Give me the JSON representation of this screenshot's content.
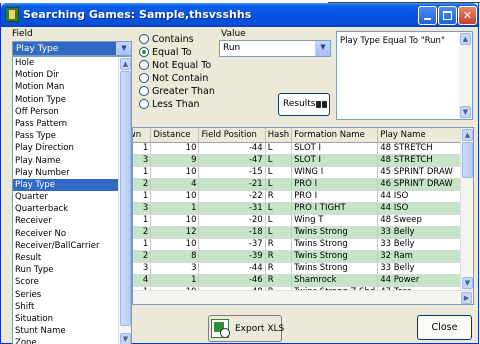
{
  "window": {
    "title": "Searching Games: Sample,thsvsshhs"
  },
  "field": {
    "label": "Field",
    "selected": "Play Type",
    "options": [
      "Hole",
      "Motion Dir",
      "Motion Man",
      "Motion Type",
      "Off Person",
      "Pass Pattern",
      "Pass Type",
      "Play Direction",
      "Play Name",
      "Play Number",
      "Play Type",
      "Quarter",
      "Quarterback",
      "Receiver",
      "Receiver No",
      "Receiver/BallCarrier",
      "Result",
      "Run Type",
      "Score",
      "Series",
      "Shift",
      "Situation",
      "Stunt Name",
      "Zone"
    ]
  },
  "operators": [
    {
      "label": "Contains",
      "selected": false
    },
    {
      "label": "Equal To",
      "selected": true
    },
    {
      "label": "Not Equal To",
      "selected": false
    },
    {
      "label": "Not Contain",
      "selected": false
    },
    {
      "label": "Greater Than",
      "selected": false
    },
    {
      "label": "Less Than",
      "selected": false
    }
  ],
  "value": {
    "label": "Value",
    "selected": "Run"
  },
  "results_button": {
    "label": "Results"
  },
  "description": {
    "text": "Play Type Equal To \"Run\""
  },
  "grid": {
    "columns": [
      "Down",
      "Distance",
      "Field Position",
      "Hash",
      "Formation Name",
      "Play Name"
    ],
    "rows": [
      [
        "1",
        "10",
        "-44",
        "L",
        "SLOT I",
        "48 STRETCH"
      ],
      [
        "3",
        "9",
        "-47",
        "L",
        "SLOT I",
        "48 STRETCH"
      ],
      [
        "1",
        "10",
        "-15",
        "L",
        "WING I",
        "45 SPRINT DRAW"
      ],
      [
        "2",
        "4",
        "-21",
        "L",
        "PRO I",
        "46 SPRINT DRAW"
      ],
      [
        "1",
        "10",
        "-22",
        "R",
        "PRO I",
        "44 ISO"
      ],
      [
        "3",
        "1",
        "-31",
        "L",
        "PRO I TIGHT",
        "44 ISO"
      ],
      [
        "1",
        "10",
        "-20",
        "L",
        "Wing T",
        "48 Sweep"
      ],
      [
        "2",
        "12",
        "-18",
        "L",
        "Twins Strong",
        "33 Belly"
      ],
      [
        "1",
        "10",
        "-37",
        "R",
        "Twins Strong",
        "33 Belly"
      ],
      [
        "2",
        "8",
        "-39",
        "R",
        "Twins Strong",
        "32 Ram"
      ],
      [
        "3",
        "3",
        "-44",
        "R",
        "Twins Strong",
        "33 Belly"
      ],
      [
        "4",
        "1",
        "-46",
        "R",
        "Shamrock",
        "44 Power"
      ],
      [
        "1",
        "10",
        "48",
        "R",
        "Twins Strong Z Shd",
        "47 Toss"
      ]
    ]
  },
  "export_button": {
    "label": "Export XLS"
  },
  "close_button": {
    "label": "Close"
  },
  "colors": {
    "title_bar": "#0553e3",
    "row_alt": "#c6e4c6",
    "selection": "#316ac5"
  }
}
